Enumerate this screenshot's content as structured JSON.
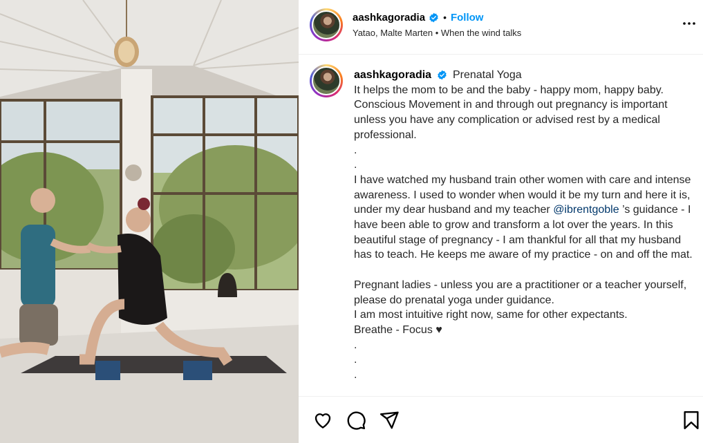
{
  "post": {
    "username": "aashkagoradia",
    "follow_label": "Follow",
    "separator": "•",
    "audio_artists": "Yatao, Malte Marten",
    "audio_separator": "•",
    "audio_track": "When the wind talks"
  },
  "caption": {
    "username": "aashkagoradia",
    "title": "Prenatal Yoga",
    "lines": [
      "It helps the mom to be and the baby - happy mom, happy baby.",
      "Conscious Movement in and through out pregnancy is important unless you have any complication or advised rest by a medical professional.",
      ".",
      ".",
      "I have watched my husband train other women with care and intense awareness. I used to wonder when would it be my turn and here it is, under my dear husband and my teacher",
      "@ibrentgoble",
      "’s guidance - I have been able to grow and transform a lot over the years. In this beautiful stage of pregnancy - I am thankful for all that my husband has to teach. He keeps me aware of my practice - on and off the mat.",
      "Pregnant ladies - unless you are a practitioner or a teacher yourself, please do prenatal yoga under guidance.",
      "I am most intuitive right now, same for other expectants.",
      "Breathe - Focus ♥",
      ".",
      ".",
      "."
    ]
  },
  "icons": {
    "verified": "verified-badge-icon",
    "more": "more-options-icon",
    "like": "heart-icon",
    "comment": "comment-icon",
    "share": "share-icon",
    "save": "bookmark-icon"
  },
  "colors": {
    "accent": "#0095f6",
    "mention": "#00376b",
    "verified": "#0095f6"
  }
}
